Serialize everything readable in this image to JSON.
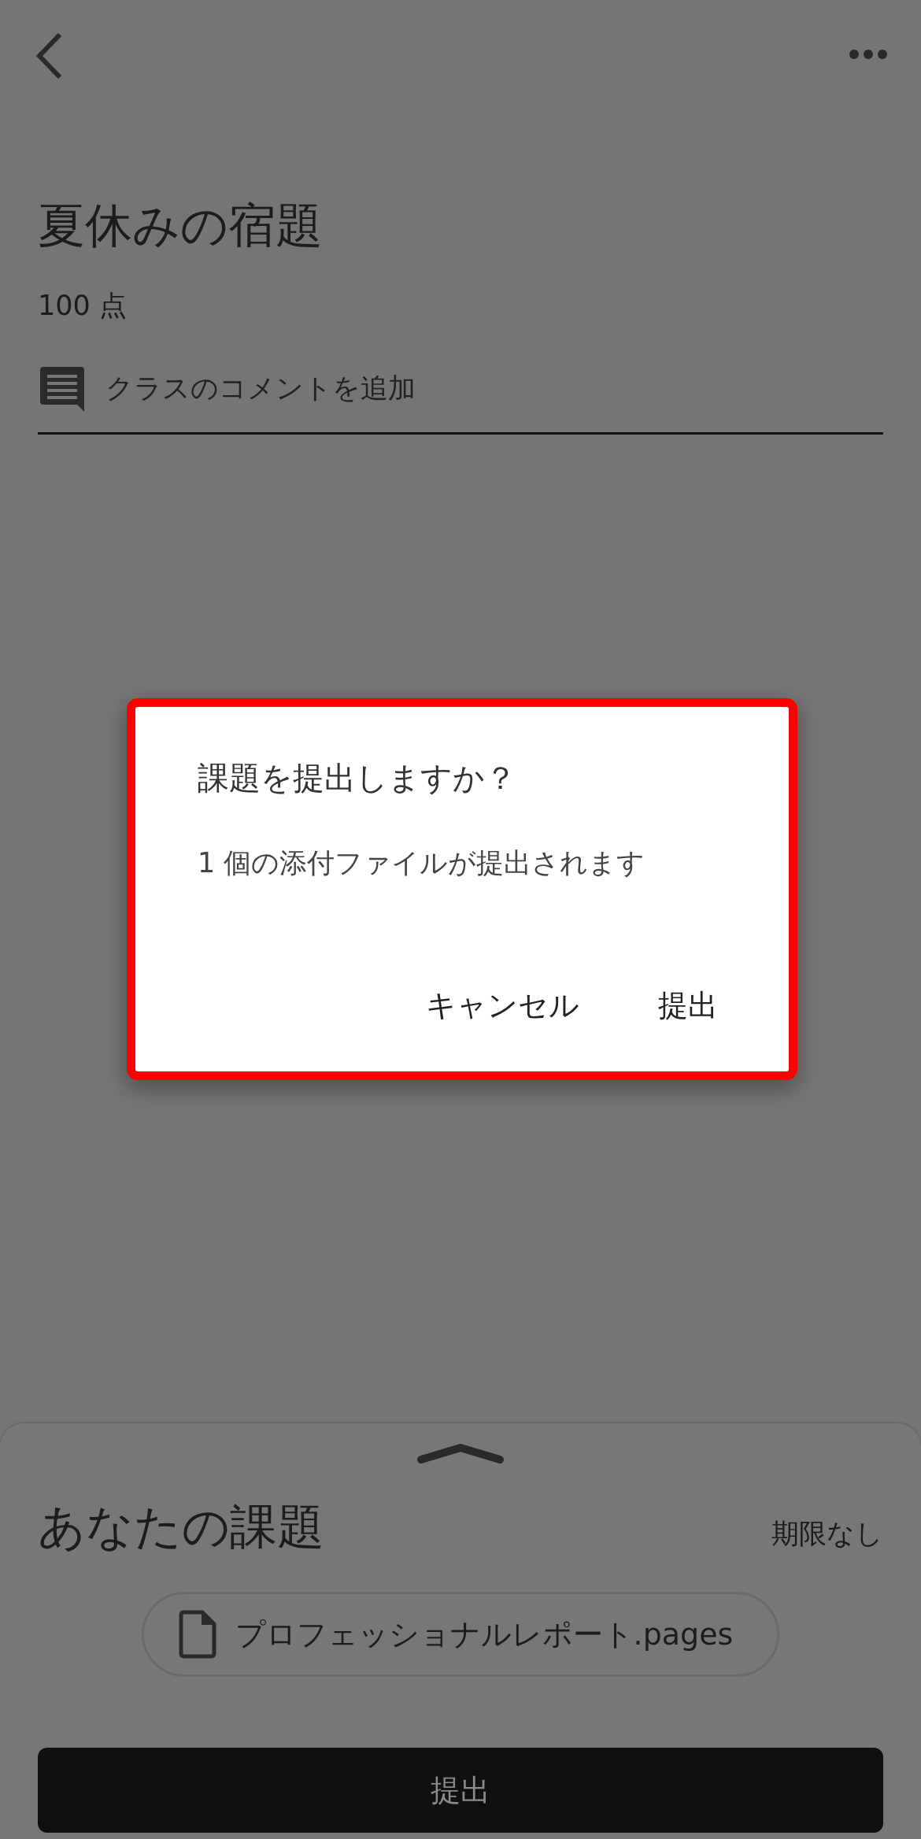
{
  "assignment": {
    "title": "夏休みの宿題",
    "points": "100 点",
    "comment_placeholder": "クラスのコメントを追加"
  },
  "dialog": {
    "title": "課題を提出しますか？",
    "message": "1 個の添付ファイルが提出されます",
    "highlighted": true,
    "buttons": [
      {
        "label": "キャンセル"
      },
      {
        "label": "提出"
      }
    ]
  },
  "your_work": {
    "title": "あなたの課題",
    "due": "期限なし",
    "attachments": [
      {
        "name": "プロフェッショナルレポート.pages"
      }
    ],
    "submit_button": "提出"
  }
}
